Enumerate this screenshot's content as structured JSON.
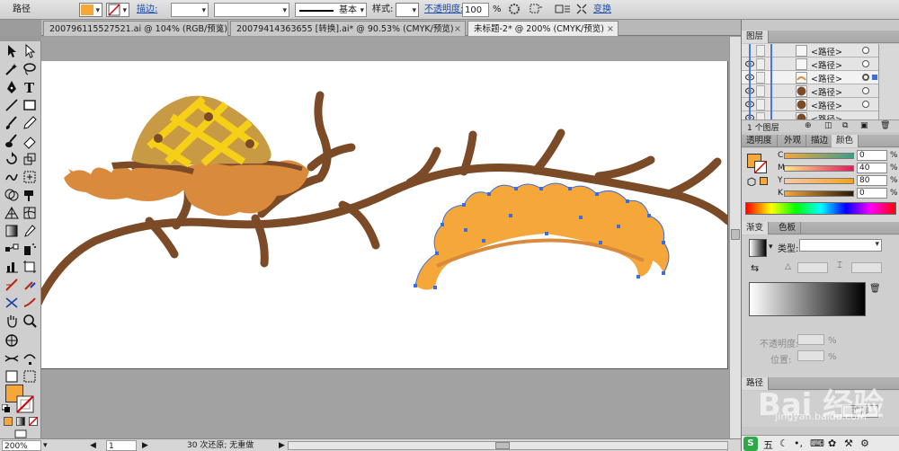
{
  "control_bar": {
    "object_type": "路径",
    "fill_color": "#f5a73a",
    "stroke_label": "描边:",
    "stroke_weight": "",
    "stroke_profile_label": "基本",
    "style_label": "样式:",
    "opacity_label": "不透明度:",
    "opacity_value": "100",
    "opacity_unit": "%",
    "transform_label": "变换"
  },
  "tabs": [
    {
      "label": "200796115527521.ai @ 104% (RGB/预览)",
      "close": "×"
    },
    {
      "label": "20079414363655 [转换].ai* @ 90.53% (CMYK/预览)",
      "close": "×"
    },
    {
      "label": "未标题-2* @ 200% (CMYK/预览)",
      "close": "×"
    }
  ],
  "status_bar": {
    "zoom": "200%",
    "page": "1",
    "undo_info": "30 次还原; 无重做"
  },
  "layers_panel": {
    "title": "图层",
    "rows": [
      {
        "label": "<路径>"
      },
      {
        "label": "<路径>"
      },
      {
        "label": "<路径>"
      },
      {
        "label": "<路径>"
      },
      {
        "label": "<路径>"
      },
      {
        "label": "<路径>"
      }
    ],
    "footer": "1 个图层"
  },
  "color_panel": {
    "tabs": [
      "透明度",
      "外观",
      "描边",
      "颜色"
    ],
    "channels": [
      {
        "key": "C",
        "value": "0",
        "unit": "%"
      },
      {
        "key": "M",
        "value": "40",
        "unit": "%"
      },
      {
        "key": "Y",
        "value": "80",
        "unit": "%"
      },
      {
        "key": "K",
        "value": "0",
        "unit": "%"
      }
    ]
  },
  "gradient_panel": {
    "tabs": [
      "渐变",
      "色板"
    ],
    "type_label": "类型:",
    "opacity_label": "不透明度:",
    "location_label": "位置:",
    "unit": "%"
  },
  "bottom_panel": {
    "tab": "路径",
    "button": "扩展",
    "watermark_text": "Bai 经验",
    "watermark_url": "jingyan.baidu.com"
  },
  "taskbar": {
    "ime": "五"
  },
  "colors": {
    "branch": "#7b4a27",
    "orange": "#f5a73a",
    "dark_orange": "#d98a3c",
    "tan": "#c99a44",
    "yellow": "#f5d016",
    "selection": "#3b6de0"
  }
}
